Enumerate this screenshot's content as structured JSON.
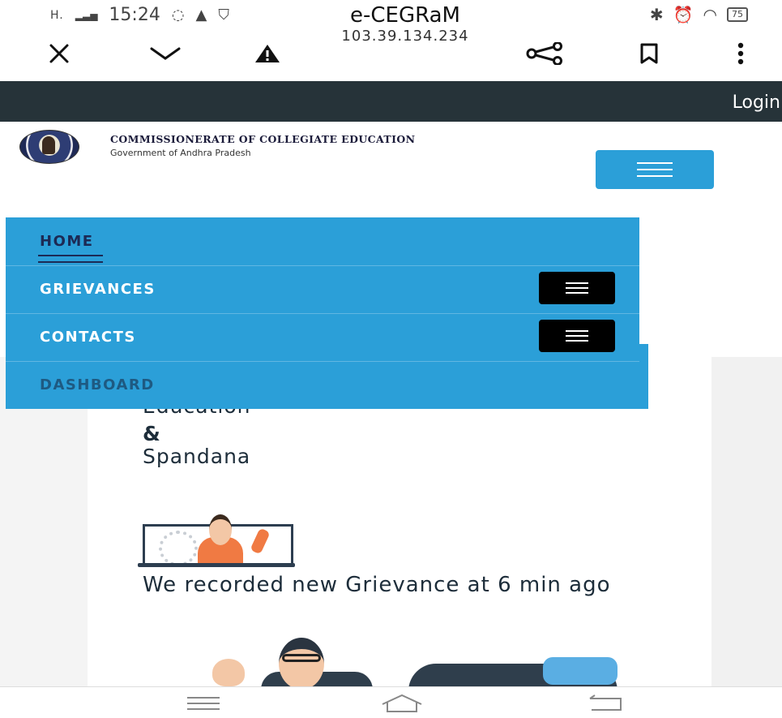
{
  "status_bar": {
    "signal": "H.",
    "time": "15:24",
    "battery": "75"
  },
  "browser": {
    "title": "e-CEGRaM",
    "url": "103.39.134.234"
  },
  "top_strip": {
    "login": "Login"
  },
  "header": {
    "org_name": "COMMISSIONERATE OF COLLEGIATE EDUCATION",
    "org_sub": "Government of Andhra Pradesh"
  },
  "nav": {
    "items": [
      {
        "label": "HOME"
      },
      {
        "label": "GRIEVANCES"
      },
      {
        "label": "CONTACTS"
      },
      {
        "label": "DASHBOARD"
      }
    ]
  },
  "hero": {
    "line1": "Education",
    "line2": "&",
    "line3": "Spandana"
  },
  "notice": {
    "text": "We recorded new Grievance at 6 min ago"
  },
  "colors": {
    "nav_blue": "#2b9fd8",
    "dark_strip": "#263339",
    "toggle_black": "#000000"
  }
}
